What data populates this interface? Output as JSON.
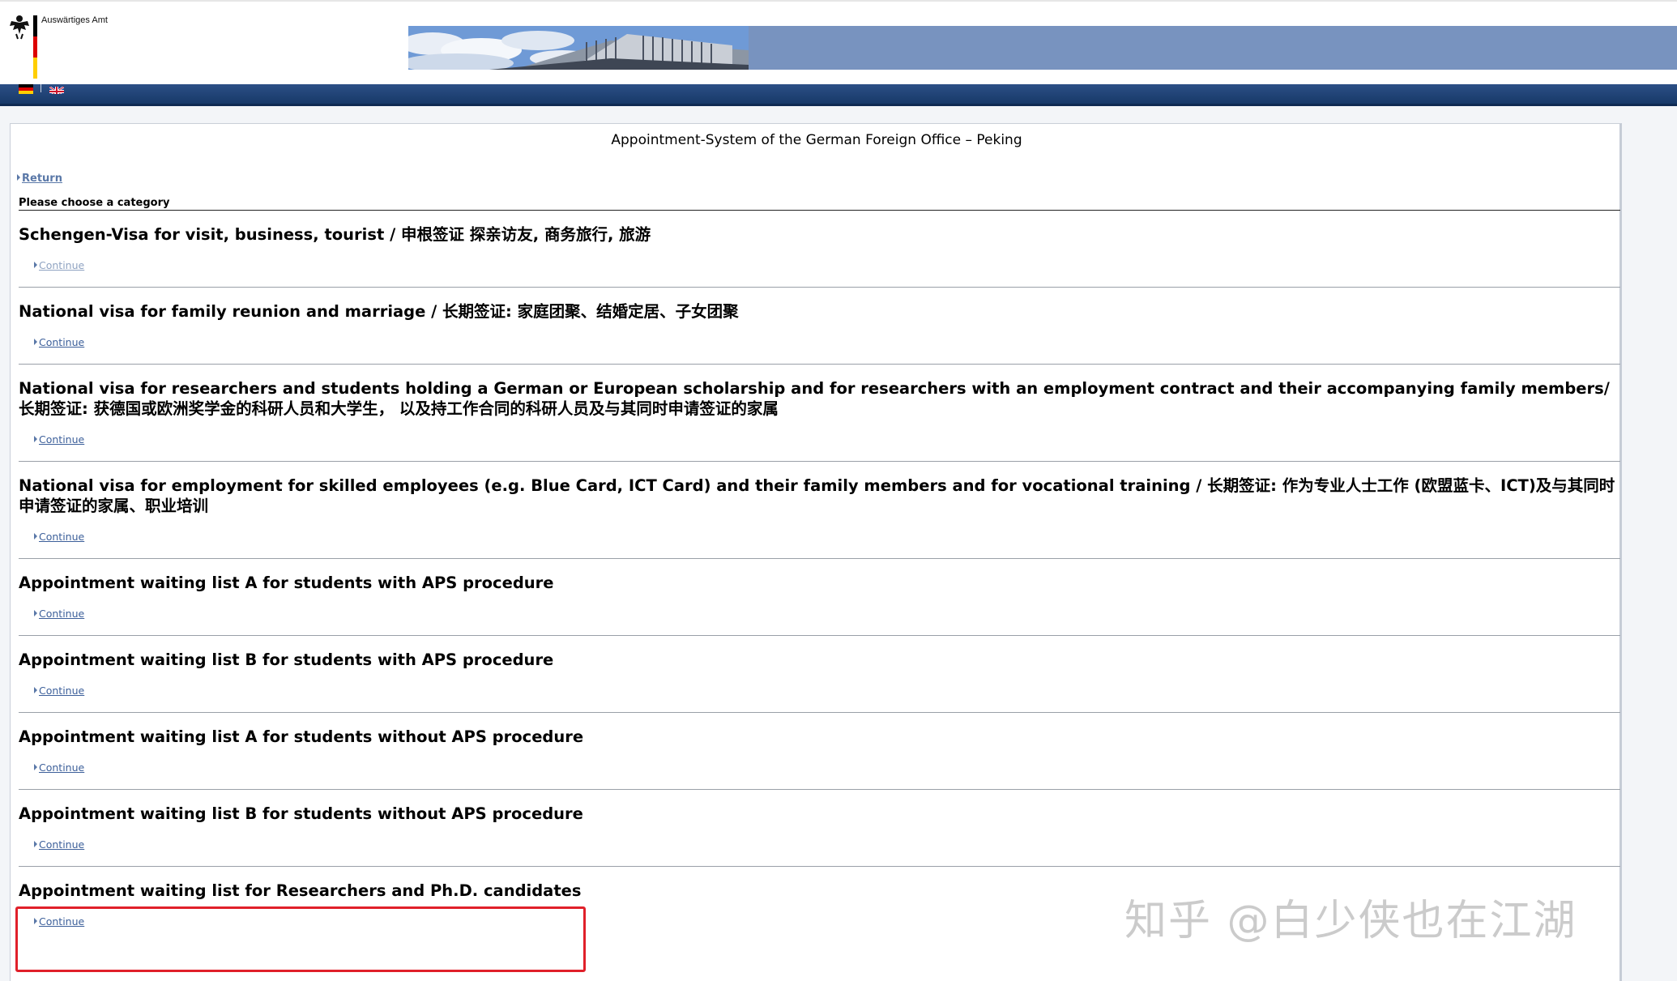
{
  "header": {
    "org_name": "Auswärtiges Amt",
    "flag_colors": [
      "#000000",
      "#dd0000",
      "#ffce00"
    ],
    "languages": [
      {
        "code": "de",
        "icon": "german-flag-icon"
      },
      {
        "code": "en",
        "icon": "uk-flag-icon"
      }
    ]
  },
  "page": {
    "title": "Appointment-System of the German Foreign Office – Peking",
    "return_label": "Return",
    "choose_label": "Please choose a category"
  },
  "categories": [
    {
      "title": "Schengen-Visa for visit, business, tourist / 申根签证 探亲访友, 商务旅行, 旅游",
      "link": "Continue"
    },
    {
      "title": "National visa for family reunion and marriage / 长期签证: 家庭团聚、结婚定居、子女团聚",
      "link": "Continue"
    },
    {
      "title": "National visa for researchers and students holding a German or European scholarship and for researchers with an employment contract and their accompanying family members/长期签证: 获德国或欧洲奖学金的科研人员和大学生， 以及持工作合同的科研人员及与其同时申请签证的家属",
      "link": "Continue"
    },
    {
      "title": "National visa for employment for skilled employees (e.g. Blue Card, ICT Card) and their family members and for vocational training / 长期签证: 作为专业人士工作 (欧盟蓝卡、ICT)及与其同时申请签证的家属、职业培训",
      "link": "Continue"
    },
    {
      "title": "Appointment waiting list A for students with APS procedure",
      "link": "Continue"
    },
    {
      "title": "Appointment waiting list B for students with APS procedure",
      "link": "Continue"
    },
    {
      "title": "Appointment waiting list A for students without APS procedure",
      "link": "Continue"
    },
    {
      "title": "Appointment waiting list B for students without APS procedure",
      "link": "Continue"
    },
    {
      "title": "Appointment waiting list for Researchers and Ph.D. candidates",
      "link": "Continue"
    }
  ],
  "watermark": "知乎 @白少侠也在江湖",
  "accent_colors": {
    "navbar": "#173968",
    "link": "#3c5f9a",
    "highlight": "#e0202a"
  }
}
